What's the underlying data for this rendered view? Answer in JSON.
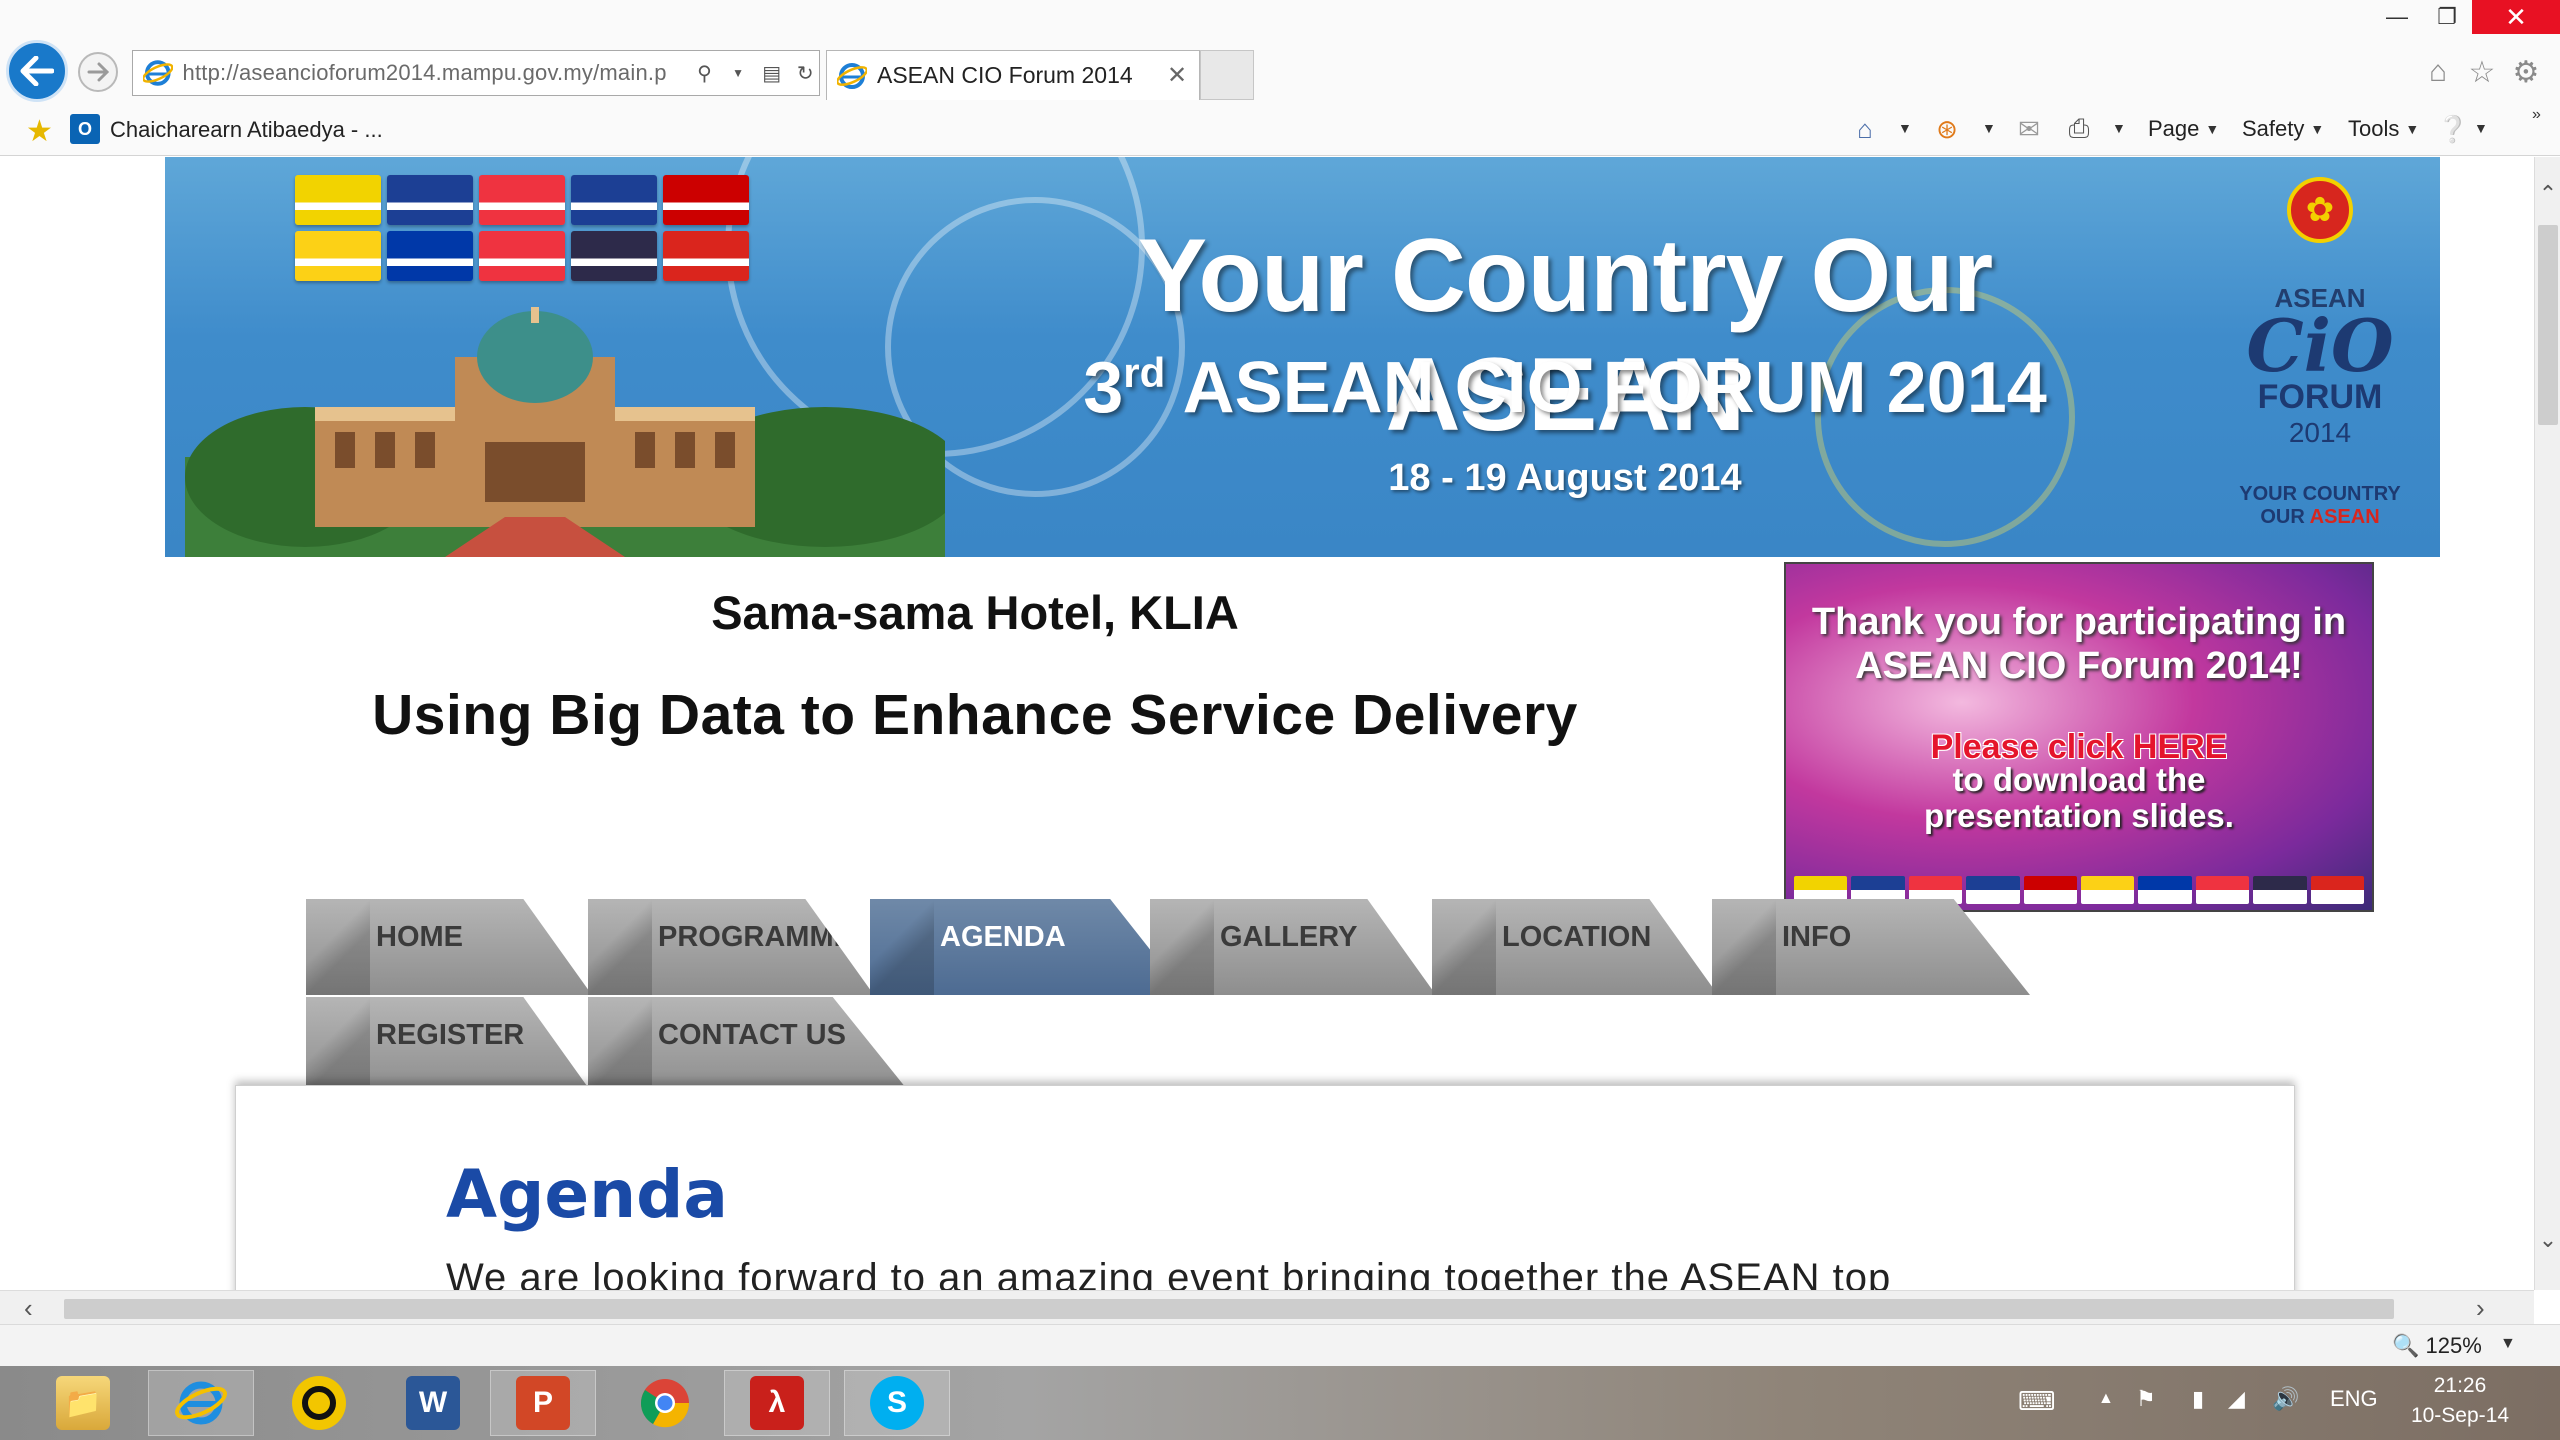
{
  "window": {
    "minimize_icon": "minimize-icon",
    "maximize_icon": "restore-icon",
    "close_icon": "close-icon"
  },
  "browser": {
    "url": "http://aseancioforum2014.mampu.gov.my/main.p",
    "tab_title": "ASEAN CIO Forum 2014",
    "favorites_link": "Chaicharearn Atibaedya - ...",
    "commands": {
      "page": "Page",
      "safety": "Safety",
      "tools": "Tools"
    },
    "zoom": "125%"
  },
  "banner": {
    "headline": "Your Country Our ASEAN",
    "forum_prefix": "3",
    "forum_sup": "rd",
    "forum_rest": " ASEAN CIO FORUM 2014",
    "dates": "18 - 19 August 2014",
    "logo_asean": "ASEAN",
    "logo_cio": "CiO",
    "logo_forum": "FORUM",
    "logo_year": "2014",
    "logo_tag1": "YOUR COUNTRY",
    "logo_tag2_a": "OUR ",
    "logo_tag2_b": "ASEAN",
    "flag_colors": [
      "#f2d300",
      "#1c3f94",
      "#ef3340",
      "#1c3f94",
      "#cc0000",
      "#fcd116",
      "#0038a8",
      "#ef3340",
      "#2d2a4a",
      "#da251d"
    ]
  },
  "venue": "Sama-sama Hotel, KLIA",
  "theme": "Using Big Data to Enhance Service Delivery",
  "promo": {
    "line1": "Thank you for participating in",
    "line2": "ASEAN CIO Forum 2014!",
    "click": "Please click HERE",
    "download1": "to download the",
    "download2": "presentation slides."
  },
  "nav": {
    "tabs": [
      "HOME",
      "PROGRAMME",
      "AGENDA",
      "GALLERY",
      "LOCATION",
      "INFO",
      "REGISTER",
      "CONTACT US"
    ],
    "active": "AGENDA"
  },
  "content": {
    "title": "Agenda",
    "intro": "We are looking forward to an amazing event bringing together the ASEAN top"
  },
  "taskbar": {
    "apps": [
      "file-explorer-icon",
      "internet-explorer-icon",
      "norton-icon",
      "word-icon",
      "powerpoint-icon",
      "chrome-icon",
      "acrobat-icon",
      "skype-icon"
    ],
    "lang": "ENG",
    "time": "21:26",
    "date": "10-Sep-14"
  }
}
